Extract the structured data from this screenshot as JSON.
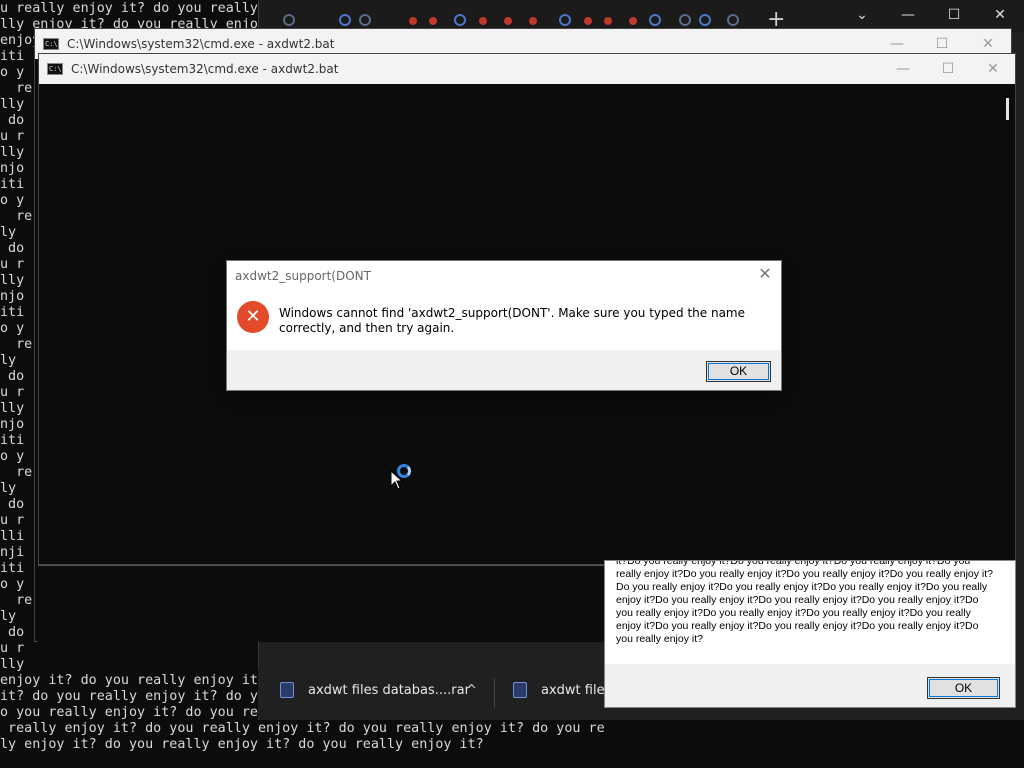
{
  "background_console": {
    "lines": [
      "u really enjoy it? do you really",
      "lly enjoy it? do you really enjoy",
      "enjoy",
      "iti",
      "o y",
      "  re",
      "lly",
      " do",
      "u r",
      "lly",
      "njo",
      "iti",
      "o y",
      "  re",
      "ly",
      " do",
      "u r",
      "lly",
      "njo",
      "iti",
      "o y",
      "  re",
      "ly",
      " do",
      "u r",
      "lly",
      "njo",
      "iti",
      "o y",
      "  re",
      "ly",
      " do",
      "u r",
      "lli",
      "nji",
      "iti",
      "o y",
      "  re",
      "ly",
      " do",
      "u r",
      "lly",
      "enjoy it? do you really enjoy it",
      "it? do you really enjoy it? do y",
      "o you really enjoy it? do you re",
      " really enjoy it? do you really enjoy it? do you really enjoy it? do you re",
      "ly enjoy it? do you really enjoy it? do you really enjoy it?"
    ]
  },
  "browser": {
    "controls": {
      "minimize": "⌄",
      "restore": "—",
      "maximize": "☐",
      "close": "✕"
    },
    "new_tab": "+"
  },
  "cmd_back": {
    "title": "C:\\Windows\\system32\\cmd.exe - axdwt2.bat",
    "icon_text": "C:\\",
    "controls": {
      "minimize": "—",
      "maximize": "☐",
      "close": "✕"
    }
  },
  "cmd_front": {
    "title": "C:\\Windows\\system32\\cmd.exe - axdwt2.bat",
    "icon_text": "C:\\",
    "controls": {
      "minimize": "—",
      "maximize": "☐",
      "close": "✕"
    }
  },
  "downloads": {
    "items": [
      {
        "label": "axdwt files databas....rar",
        "chevron": "^"
      },
      {
        "label": "axdwt files"
      }
    ]
  },
  "error_dialog": {
    "title": "axdwt2_support(DONT",
    "close": "✕",
    "icon": "✕",
    "message": "Windows cannot find 'axdwt2_support(DONT'. Make sure you typed the name correctly, and then try again.",
    "ok_label": "OK"
  },
  "spam_box": {
    "text": "it?Do you really enjoy it?Do you really enjoy it?Do you really enjoy it?Do you really enjoy it?Do you really enjoy it?Do you really enjoy it?Do you really enjoy it?Do you really enjoy it?Do you really enjoy it?Do you really enjoy it?Do you really enjoy it?Do you really enjoy it?Do you really enjoy it?Do you really enjoy it?Do you really enjoy it?Do you really enjoy it?Do you really enjoy it?Do you really enjoy it?Do you really enjoy it?Do you really enjoy it?Do you really enjoy it?Do you really enjoy it?",
    "ok_label": "OK"
  },
  "colors": {
    "console_bg": "#0c0c0c",
    "error_red": "#e34a2a",
    "focus_blue": "#0078d7"
  }
}
